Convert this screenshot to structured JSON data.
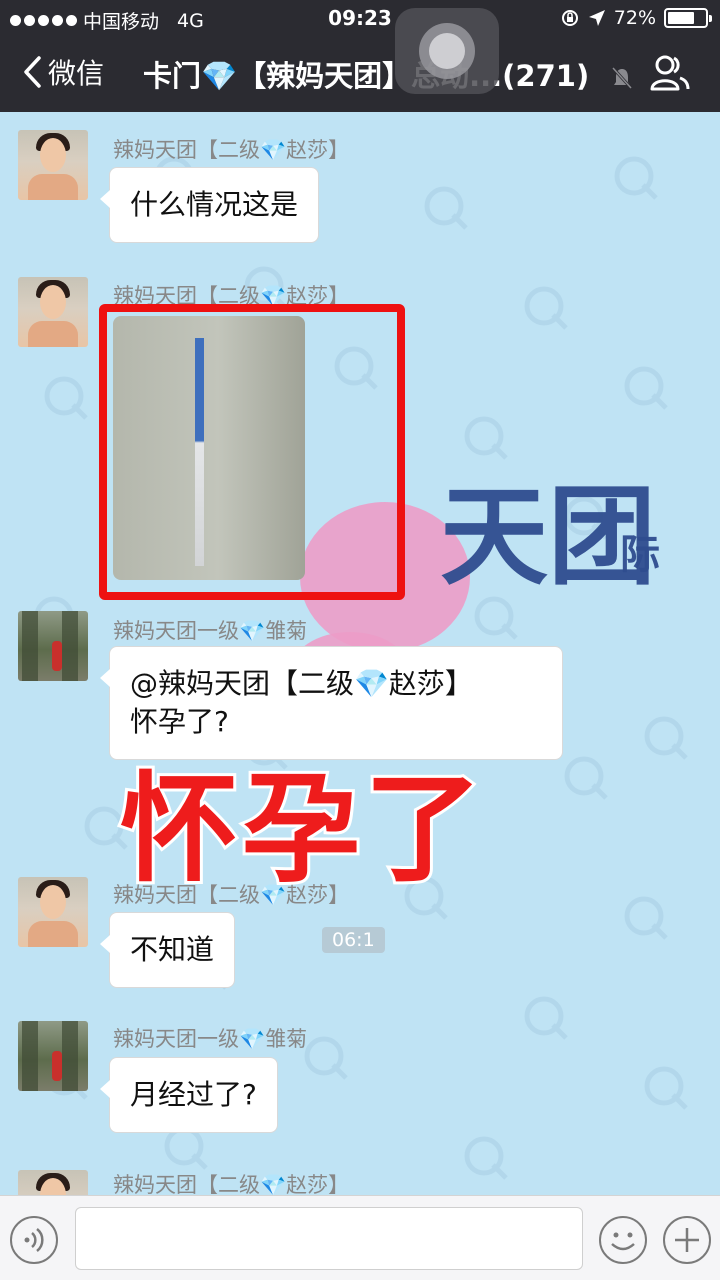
{
  "status_bar": {
    "carrier": "中国移动",
    "network": "4G",
    "time": "09:23",
    "battery": "72%",
    "battery_level": 0.72
  },
  "nav": {
    "back_label": "微信",
    "title": "卡门💎【辣妈天团】总动...(271)"
  },
  "background": {
    "watermark_text": "天团",
    "watermark_sub": "际"
  },
  "messages": [
    {
      "sender": "辣妈天团【二级💎赵莎】",
      "text": "什么情况这是"
    },
    {
      "sender": "辣妈天团【二级💎赵莎】"
    },
    {
      "sender": "辣妈天团一级💎雏菊",
      "line1": "@辣妈天团【二级💎赵莎】",
      "line2": "怀孕了?"
    },
    {
      "sender": "辣妈天团【二级💎赵莎】",
      "text": "不知道"
    },
    {
      "sender": "辣妈天团一级💎雏菊",
      "text": "月经过了?"
    },
    {
      "sender": "辣妈天团【二级💎赵莎】"
    }
  ],
  "timestamp": "06:1",
  "overlay_caption": "怀孕了",
  "colors": {
    "nav_bg": "#2b2b31",
    "chat_bg": "#bfe3f4",
    "highlight_red": "#ee1111"
  }
}
